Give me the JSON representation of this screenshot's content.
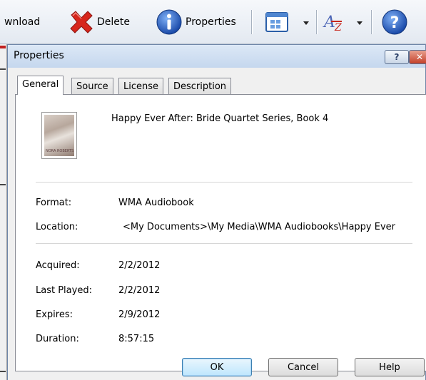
{
  "toolbar": {
    "download_label": "wnload",
    "delete_label": "Delete",
    "properties_label": "Properties"
  },
  "dialog": {
    "title": "Properties",
    "help_caption": "?",
    "close_caption": "✕",
    "tabs": [
      {
        "label": "General",
        "active": true
      },
      {
        "label": "Source",
        "active": false
      },
      {
        "label": "License",
        "active": false
      },
      {
        "label": "Description",
        "active": false
      }
    ],
    "book_title": "Happy Ever After: Bride Quartet Series, Book 4",
    "cover_text": "NORA ROBERTS",
    "fields": {
      "format_label": "Format:",
      "format_value": "WMA Audiobook",
      "location_label": "Location:",
      "location_value": "<My Documents>\\My Media\\WMA Audiobooks\\Happy Ever",
      "acquired_label": "Acquired:",
      "acquired_value": "2/2/2012",
      "last_played_label": "Last Played:",
      "last_played_value": "2/2/2012",
      "expires_label": "Expires:",
      "expires_value": "2/9/2012",
      "duration_label": "Duration:",
      "duration_value": "8:57:15"
    },
    "buttons": {
      "ok": "OK",
      "cancel": "Cancel",
      "help": "Help"
    }
  },
  "colors": {
    "accent": "#3c7fb1",
    "delete_red": "#d7261c",
    "info_blue": "#2160c4"
  },
  "icons": [
    "delete-x-icon",
    "info-icon",
    "view-grid-icon",
    "sort-az-icon",
    "help-circle-icon"
  ]
}
